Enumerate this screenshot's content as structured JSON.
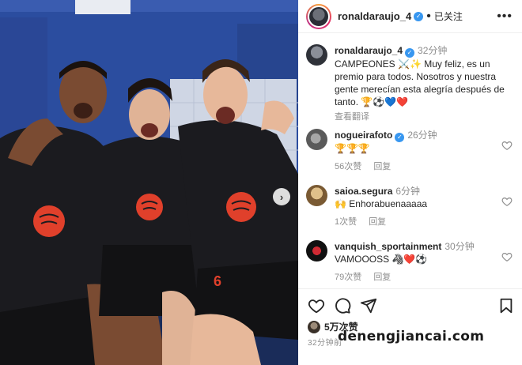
{
  "header": {
    "username": "ronaldaraujo_4",
    "separator": "•",
    "follow_status": "已关注",
    "more_icon": "more-horizontal-icon"
  },
  "caption": {
    "username": "ronaldaraujo_4",
    "time": "32分钟",
    "text": "CAMPEONES ⚔️✨ Muy feliz, es un premio para todos. Nosotros y nuestra gente merecían esta alegría después de tanto. 🏆⚽💙❤️",
    "translate": "查看翻译"
  },
  "comments": [
    {
      "username": "nogueirafoto",
      "verified": true,
      "time": "26分钟",
      "text": "🏆🏆🏆",
      "likes": "56次赞",
      "reply": "回复",
      "avatar_color": "#6b6b6b"
    },
    {
      "username": "saioa.segura",
      "verified": false,
      "time": "6分钟",
      "text": "🙌 Enhorabuenaaaaa",
      "likes": "1次赞",
      "reply": "回复",
      "avatar_color": "#c9a26a"
    },
    {
      "username": "vanquish_sportainment",
      "verified": false,
      "time": "30分钟",
      "text": "VAMOOOSS 🦓❤️⚽",
      "likes": "79次赞",
      "reply": "回复",
      "avatar_color": "#b01b22"
    }
  ],
  "actions": {
    "like_icon": "heart-icon",
    "comment_icon": "comment-icon",
    "share_icon": "send-icon",
    "save_icon": "bookmark-icon"
  },
  "likes_count": "5万次赞",
  "post_time": "32分钟前",
  "watermark": "denengjiancai.com",
  "colors": {
    "accent_blue": "#3897f0",
    "kit_dark": "#1b1b1f",
    "sponsor_red": "#e0402b",
    "wall_blue": "#2a4a9c"
  }
}
